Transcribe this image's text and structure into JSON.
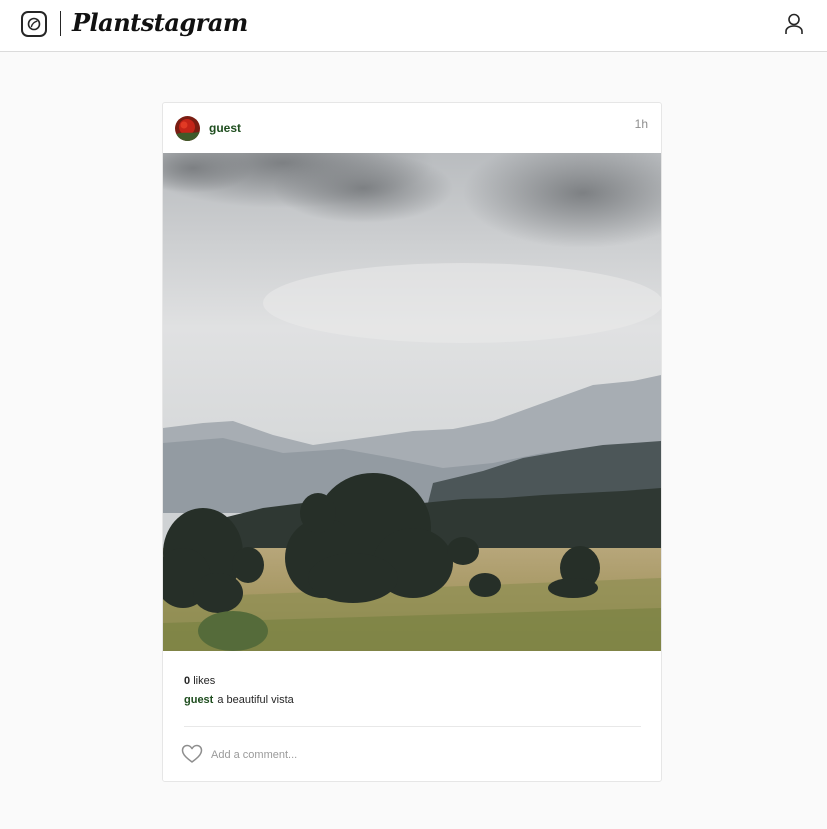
{
  "app": {
    "title": "Plantstagram",
    "logo_icon": "leaf-icon",
    "profile_icon": "user-icon"
  },
  "post": {
    "author": "guest",
    "time": "1h",
    "image_description_icon": "landscape-photo",
    "likes_count": "0",
    "likes_label": "likes",
    "caption_author": "guest",
    "caption_text": "a beautiful vista",
    "comment_placeholder": "Add a comment...",
    "like_icon": "heart-icon"
  },
  "colors": {
    "author": "#1e4d1e",
    "border": "#dbdbdb",
    "background": "#fafafa"
  }
}
